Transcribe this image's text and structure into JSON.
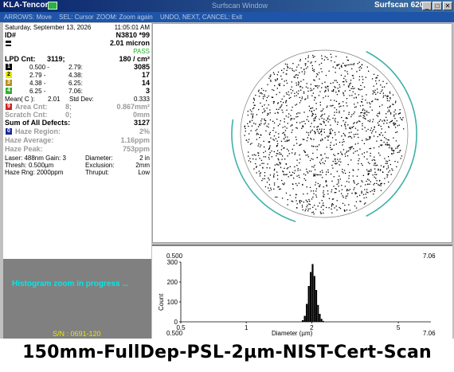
{
  "window": {
    "app_name": "KLA-Tencor",
    "title": "Surfscan Window",
    "product": "Surfscan 6200",
    "controls": [
      "_",
      "□",
      "✕"
    ]
  },
  "menubar": {
    "items": [
      "ARROWS: Move",
      "SEL: Cursor",
      "ZOOM: Zoom again",
      "UNDO, NEXT, CANCEL: Exit"
    ]
  },
  "info": {
    "date": "Saturday, September 13, 2026",
    "time": "11:05:01 AM",
    "id_label": "ID#",
    "id_value": "N3810 *99",
    "micron": "2.01 micron",
    "pass": "PASS",
    "lpd_label": "LPD Cnt:",
    "lpd_count": "3119;",
    "lpd_density": "180 / cm²",
    "bins": [
      {
        "num": "1",
        "from": "0.500 -",
        "to": "2.79:",
        "count": "3085",
        "color": "#000000"
      },
      {
        "num": "2",
        "from": "2.79 -",
        "to": "4.38:",
        "count": "17",
        "color": "#e8e800"
      },
      {
        "num": "3",
        "from": "4.38 -",
        "to": "6.25:",
        "count": "14",
        "color": "#b89020"
      },
      {
        "num": "4",
        "from": "6.25 -",
        "to": "7.06:",
        "count": "3",
        "color": "#30b030"
      }
    ],
    "mean_label": "Mean( C ):",
    "mean_value": "2.01",
    "stddev_label": "Std Dev:",
    "stddev_value": "0.333",
    "area_num": "9",
    "area_label": "Area Cnt:",
    "area_count": "8;",
    "area_value": "0.867mm²",
    "scratch_label": "Scratch Cnt:",
    "scratch_count": "0;",
    "scratch_value": "0mm",
    "sum_label": "Sum of All Defects:",
    "sum_value": "3127",
    "haze_num": "0",
    "haze_region_label": "Haze Region:",
    "haze_region_value": "2%",
    "haze_avg_label": "Haze Average:",
    "haze_avg_value": "1.16ppm",
    "haze_peak_label": "Haze Peak:",
    "haze_peak_value": "753ppm",
    "laser": "Laser: 488nm Gain: 3",
    "diameter_label": "Diameter:",
    "diameter_value": "2 in",
    "thresh": "Thresh:",
    "thresh_value": "0.500µm",
    "exclusion_label": "Exclusion:",
    "exclusion_value": "2mm",
    "haze_rng": "Haze Rng: 2000ppm",
    "thruput_label": "Thruput:",
    "thruput_value": "Low"
  },
  "status": {
    "message": "Histogram zoom in progress ...",
    "serial": "S/N : 0691-120"
  },
  "colors": {
    "ring": "#40b0a8",
    "defect": "#000000",
    "map_border": "#606060",
    "title_bar": "#0a246a",
    "status_text": "#00e8e8"
  },
  "chart_data": {
    "type": "bar",
    "title": "",
    "xlabel": "Diameter (µm)",
    "ylabel": "Count",
    "x_scale": "log",
    "xlim": [
      0.5,
      7.06
    ],
    "ylim": [
      0,
      300
    ],
    "x_tick_labels": [
      "0.5",
      "1",
      "2",
      "5"
    ],
    "y_tick_labels": [
      "0",
      "100",
      "200",
      "300"
    ],
    "range_label_left": "0.500",
    "range_label_right": "7.06",
    "categories": [
      1.8,
      1.84,
      1.88,
      1.92,
      1.96,
      2.0,
      2.04,
      2.08,
      2.12,
      2.16,
      2.2,
      2.24
    ],
    "values": [
      8,
      30,
      90,
      180,
      250,
      290,
      230,
      160,
      85,
      40,
      15,
      5
    ]
  },
  "caption": "150mm-FullDep-PSL-2µm-NIST-Cert-Scan"
}
